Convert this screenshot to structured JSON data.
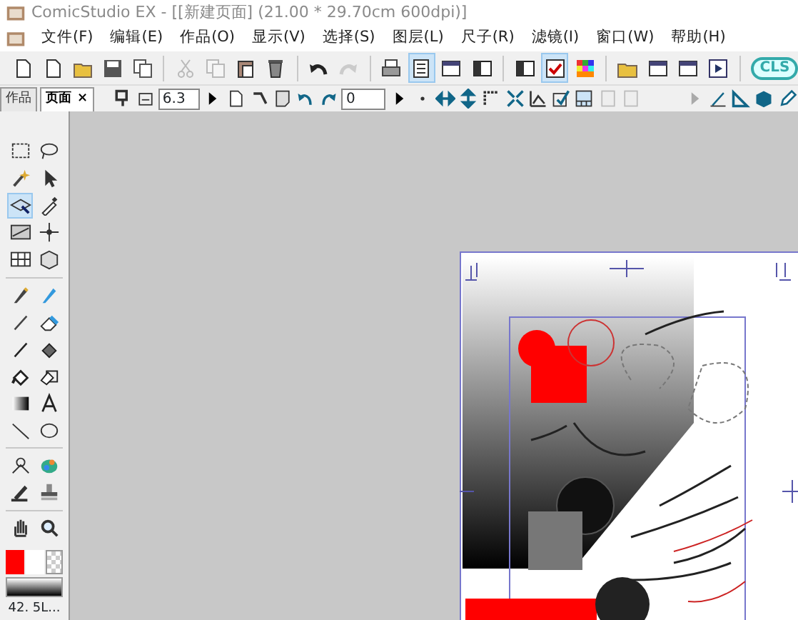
{
  "window": {
    "title": "ComicStudio EX - [[新建页面] (21.00 * 29.70cm 600dpi)]"
  },
  "menu": [
    "文件(F)",
    "编辑(E)",
    "作品(O)",
    "显示(V)",
    "选择(S)",
    "图层(L)",
    "尺子(R)",
    "滤镜(I)",
    "窗口(W)",
    "帮助(H)"
  ],
  "main_toolbar": {
    "buttons": [
      {
        "pressed": false,
        "disabled": false
      },
      {
        "pressed": false,
        "disabled": false
      },
      {
        "pressed": false,
        "disabled": false
      },
      {
        "pressed": false,
        "disabled": false
      },
      {
        "pressed": false,
        "disabled": false
      },
      {
        "pressed": false,
        "disabled": true
      },
      {
        "pressed": false,
        "disabled": true
      },
      {
        "pressed": false,
        "disabled": false
      },
      {
        "pressed": false,
        "disabled": false
      },
      {
        "pressed": false,
        "disabled": false
      },
      {
        "pressed": false,
        "disabled": true
      },
      {
        "pressed": false,
        "disabled": false
      },
      {
        "pressed": true,
        "disabled": false
      },
      {
        "pressed": false,
        "disabled": false
      },
      {
        "pressed": false,
        "disabled": false
      },
      {
        "pressed": false,
        "disabled": false
      },
      {
        "pressed": true,
        "disabled": false
      },
      {
        "pressed": false,
        "disabled": false
      },
      {
        "pressed": false,
        "disabled": false
      },
      {
        "pressed": false,
        "disabled": false
      },
      {
        "pressed": false,
        "disabled": false
      },
      {
        "pressed": false,
        "disabled": false
      }
    ],
    "logo": "CLS"
  },
  "panel_tabs": [
    {
      "label": "作品",
      "selected": false
    },
    {
      "label": "页面",
      "selected": true,
      "close": "×"
    }
  ],
  "sub_toolbar": {
    "zoom": "6.3",
    "rotation": "0"
  },
  "tools": [
    {
      "selected": false
    },
    {
      "selected": false
    },
    {
      "selected": false
    },
    {
      "selected": false
    },
    {
      "selected": true
    },
    {
      "selected": false
    },
    {
      "selected": false
    },
    {
      "selected": false
    },
    {
      "selected": false
    },
    {
      "selected": false
    },
    {
      "selected": false
    },
    {
      "selected": false
    },
    {
      "selected": false
    },
    {
      "selected": false
    },
    {
      "selected": false
    },
    {
      "selected": false
    },
    {
      "selected": false
    },
    {
      "selected": false
    },
    {
      "selected": false
    },
    {
      "selected": false
    },
    {
      "selected": false
    },
    {
      "selected": false
    },
    {
      "selected": false
    },
    {
      "selected": false
    },
    {
      "selected": false
    },
    {
      "selected": false
    },
    {
      "selected": false
    },
    {
      "selected": false
    }
  ],
  "swatches": [
    {
      "kind": "color",
      "color": "#ff0000"
    },
    {
      "kind": "color",
      "color": "#ffffff"
    },
    {
      "kind": "transparent"
    }
  ],
  "status": "42. 5L..."
}
